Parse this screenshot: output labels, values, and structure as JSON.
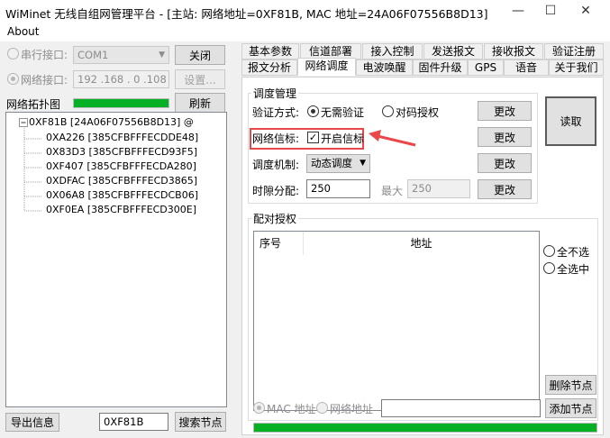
{
  "window": {
    "title": "WiMinet 无线自组网管理平台 - [主站: 网络地址=0XF81B, MAC 地址=24A06F07556B8D13]",
    "min_icon": "—",
    "max_icon": "☐",
    "close_icon": "✕"
  },
  "menu": {
    "about": "About"
  },
  "left": {
    "serial_label": "串行接口:",
    "serial_value": "COM1",
    "close_button": "关闭",
    "net_label": "网络接口:",
    "ip_value": "192 .168 .  0   .108",
    "settings_button": "设置...",
    "topology_label": "网络拓扑图",
    "topology_progress": 1.0,
    "refresh_button": "刷新",
    "tree_root": "0XF81B [24A06F07556B8D13] @",
    "tree_children": [
      "0XA226 [385CFBFFFECDDE48]",
      "0X83D3 [385CFBFFFECD93F5]",
      "0XF407 [385CFBFFFECDA280]",
      "0XDFAC [385CFBFFFECD3865]",
      "0X06A8 [385CFBFFFECDCB06]",
      "0XF0EA [385CFBFFFECD300E]"
    ],
    "export_button": "导出信息",
    "search_value": "0XF81B",
    "search_button": "搜索节点"
  },
  "tabs": {
    "row1": [
      "基本参数",
      "信道部署",
      "接入控制",
      "发送报文",
      "接收报文",
      "验证注册"
    ],
    "row2": [
      "报文分析",
      "网络调度",
      "电波唤醒",
      "固件升级",
      "GPS",
      "语音",
      "关于我们"
    ],
    "active": "网络调度"
  },
  "schedule": {
    "group_title": "调度管理",
    "auth_label": "验证方式:",
    "auth_opt1": "无需验证",
    "auth_opt2": "对码授权",
    "beacon_label": "网络信标:",
    "beacon_check": "开启信标",
    "beacon_checked": true,
    "mech_label": "调度机制:",
    "mech_value": "动态调度",
    "slot_label": "时隙分配:",
    "slot_value": "250",
    "max_label": "最大",
    "max_value": "250",
    "change_button": "更改",
    "read_button": "读取",
    "highlight_color": "#e8484a"
  },
  "pairing": {
    "group_title": "配对授权",
    "col_index": "序号",
    "col_address": "地址",
    "none_option": "全不选",
    "all_option": "全选中",
    "delete_button": "删除节点",
    "mac_option": "MAC 地址",
    "net_option": "网络地址",
    "add_button": "添加节点",
    "progress": 1.0
  }
}
